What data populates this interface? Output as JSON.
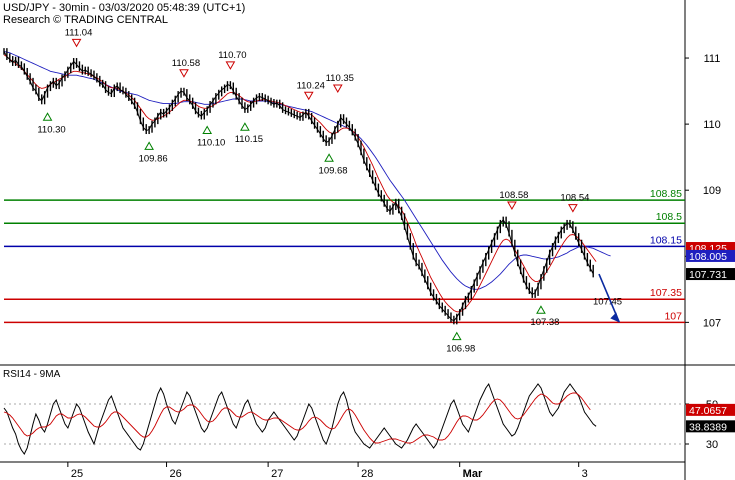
{
  "header": {
    "title": "USD/JPY - 30min - 03/03/2020 05:48:39 (UTC+1)",
    "source": "Research © TRADING CENTRAL"
  },
  "indicator_label": "RSI14 - 9MA",
  "colors": {
    "price": "#000000",
    "ma_fast": "#cc0000",
    "ma_slow": "#1f1fbf",
    "support": "#cc0000",
    "resistance": "#008000",
    "pivot": "#0000aa",
    "rsi": "#000000",
    "rsi_ma": "#cc0000",
    "arrow": "#0a2aa0",
    "grid": "#aaaaaa"
  },
  "chart_data": [
    {
      "type": "candlestick",
      "title": "USD/JPY - 30min",
      "ylim": [
        106.4,
        111.5
      ],
      "y_ticks": [
        "111",
        "110",
        "109",
        "108",
        "107"
      ],
      "x_ticks": [
        "25",
        "26",
        "27",
        "28",
        "Mar",
        "3"
      ],
      "x_range": [
        0,
        205
      ],
      "x_tick_positions": [
        22,
        56,
        91,
        122,
        157,
        198
      ],
      "last_price": "107.731",
      "price_labels": [
        {
          "label": "108.125",
          "value": 108.125,
          "color": "#cc0000"
        },
        {
          "label": "108.005",
          "value": 108.005,
          "color": "#1f1fbf"
        },
        {
          "label": "107.731",
          "value": 107.731,
          "color": "#000000"
        }
      ],
      "levels": [
        {
          "name": "resistance-2",
          "value": 108.85,
          "label": "108.85",
          "color": "#008000"
        },
        {
          "name": "resistance-1",
          "value": 108.5,
          "label": "108.5",
          "color": "#008000"
        },
        {
          "name": "pivot",
          "value": 108.15,
          "label": "108.15",
          "color": "#0000aa"
        },
        {
          "name": "support-1",
          "value": 107.35,
          "label": "107.35",
          "color": "#cc0000"
        },
        {
          "name": "support-2",
          "value": 107.0,
          "label": "107",
          "color": "#cc0000"
        }
      ],
      "swing_points": [
        {
          "x": 25,
          "value": 111.04,
          "label": "111.04",
          "kind": "high"
        },
        {
          "x": 15,
          "value": 110.3,
          "label": "110.30",
          "kind": "low"
        },
        {
          "x": 62,
          "value": 110.58,
          "label": "110.58",
          "kind": "high"
        },
        {
          "x": 78,
          "value": 110.7,
          "label": "110.70",
          "kind": "high"
        },
        {
          "x": 50,
          "value": 109.86,
          "label": "109.86",
          "kind": "low"
        },
        {
          "x": 70,
          "value": 110.1,
          "label": "110.10",
          "kind": "low"
        },
        {
          "x": 83,
          "value": 110.15,
          "label": "110.15",
          "kind": "low"
        },
        {
          "x": 105,
          "value": 110.24,
          "label": "110.24",
          "kind": "high"
        },
        {
          "x": 115,
          "value": 110.35,
          "label": "110.35",
          "kind": "high"
        },
        {
          "x": 112,
          "value": 109.68,
          "label": "109.68",
          "kind": "low"
        },
        {
          "x": 156,
          "value": 106.98,
          "label": "106.98",
          "kind": "low"
        },
        {
          "x": 175,
          "value": 108.58,
          "label": "108.58",
          "kind": "high"
        },
        {
          "x": 196,
          "value": 108.54,
          "label": "108.54",
          "kind": "high"
        },
        {
          "x": 185,
          "value": 107.38,
          "label": "107.38",
          "kind": "low"
        }
      ],
      "projection": {
        "from": [
          205,
          107.731
        ],
        "to": [
          212,
          107.0
        ],
        "label": "107.45"
      },
      "price_series": [
        111.1,
        111.02,
        110.98,
        110.93,
        110.97,
        110.9,
        110.87,
        110.8,
        110.72,
        110.65,
        110.55,
        110.5,
        110.4,
        110.35,
        110.45,
        110.55,
        110.6,
        110.65,
        110.58,
        110.62,
        110.7,
        110.75,
        110.82,
        110.88,
        110.95,
        110.9,
        110.85,
        110.8,
        110.82,
        110.78,
        110.76,
        110.72,
        110.68,
        110.62,
        110.6,
        110.52,
        110.48,
        110.46,
        110.55,
        110.58,
        110.52,
        110.5,
        110.45,
        110.4,
        110.35,
        110.28,
        110.18,
        110.05,
        109.95,
        109.9,
        109.92,
        110.0,
        110.05,
        110.12,
        110.18,
        110.15,
        110.2,
        110.25,
        110.32,
        110.38,
        110.45,
        110.5,
        110.48,
        110.4,
        110.35,
        110.28,
        110.2,
        110.15,
        110.12,
        110.18,
        110.22,
        110.3,
        110.35,
        110.42,
        110.47,
        110.52,
        110.55,
        110.6,
        110.58,
        110.5,
        110.42,
        110.35,
        110.28,
        110.22,
        110.25,
        110.3,
        110.35,
        110.4,
        110.42,
        110.4,
        110.38,
        110.35,
        110.33,
        110.3,
        110.32,
        110.28,
        110.22,
        110.2,
        110.18,
        110.16,
        110.14,
        110.12,
        110.1,
        110.14,
        110.18,
        110.12,
        110.05,
        109.98,
        109.92,
        109.85,
        109.78,
        109.72,
        109.75,
        109.82,
        109.92,
        110.0,
        110.1,
        110.05,
        110.0,
        109.95,
        109.88,
        109.8,
        109.7,
        109.58,
        109.45,
        109.35,
        109.25,
        109.15,
        109.05,
        108.95,
        108.88,
        108.8,
        108.72,
        108.68,
        108.75,
        108.82,
        108.7,
        108.6,
        108.45,
        108.3,
        108.15,
        108.0,
        107.9,
        107.85,
        107.75,
        107.65,
        107.55,
        107.45,
        107.38,
        107.32,
        107.25,
        107.2,
        107.15,
        107.1,
        107.05,
        107.02,
        107.08,
        107.15,
        107.25,
        107.35,
        107.4,
        107.5,
        107.6,
        107.7,
        107.8,
        107.9,
        108.0,
        108.1,
        108.2,
        108.3,
        108.4,
        108.5,
        108.55,
        108.48,
        108.35,
        108.2,
        108.05,
        107.9,
        107.78,
        107.65,
        107.55,
        107.48,
        107.42,
        107.45,
        107.55,
        107.68,
        107.8,
        107.92,
        108.05,
        108.15,
        108.25,
        108.32,
        108.4,
        108.45,
        108.5,
        108.48,
        108.4,
        108.3,
        108.2,
        108.1,
        108.0,
        107.9,
        107.82,
        107.731
      ],
      "ma_fast_series": [
        111.05,
        111.02,
        110.98,
        110.95,
        110.92,
        110.88,
        110.84,
        110.8,
        110.75,
        110.7,
        110.65,
        110.6,
        110.56,
        110.54,
        110.55,
        110.57,
        110.6,
        110.63,
        110.65,
        110.68,
        110.7,
        110.72,
        110.75,
        110.78,
        110.8,
        110.8,
        110.79,
        110.78,
        110.77,
        110.76,
        110.74,
        110.72,
        110.7,
        110.67,
        110.64,
        110.6,
        110.57,
        110.55,
        110.55,
        110.54,
        110.52,
        110.5,
        110.47,
        110.44,
        110.4,
        110.36,
        110.3,
        110.24,
        110.18,
        110.12,
        110.08,
        110.06,
        110.06,
        110.08,
        110.1,
        110.12,
        110.15,
        110.18,
        110.22,
        110.26,
        110.3,
        110.34,
        110.36,
        110.36,
        110.35,
        110.33,
        110.3,
        110.27,
        110.25,
        110.24,
        110.24,
        110.26,
        110.28,
        110.31,
        110.34,
        110.38,
        110.42,
        110.46,
        110.48,
        110.48,
        110.46,
        110.43,
        110.4,
        110.36,
        110.34,
        110.33,
        110.34,
        110.35,
        110.36,
        110.37,
        110.37,
        110.36,
        110.35,
        110.34,
        110.33,
        110.32,
        110.3,
        110.28,
        110.26,
        110.24,
        110.22,
        110.2,
        110.18,
        110.17,
        110.17,
        110.16,
        110.14,
        110.1,
        110.06,
        110.02,
        109.97,
        109.92,
        109.88,
        109.86,
        109.86,
        109.88,
        109.92,
        109.94,
        109.94,
        109.93,
        109.9,
        109.86,
        109.8,
        109.73,
        109.65,
        109.56,
        109.47,
        109.38,
        109.28,
        109.18,
        109.09,
        109.0,
        108.92,
        108.86,
        108.82,
        108.8,
        108.76,
        108.7,
        108.62,
        108.52,
        108.41,
        108.3,
        108.18,
        108.08,
        107.98,
        107.88,
        107.78,
        107.68,
        107.6,
        107.52,
        107.44,
        107.37,
        107.31,
        107.26,
        107.22,
        107.18,
        107.16,
        107.16,
        107.18,
        107.22,
        107.27,
        107.33,
        107.4,
        107.48,
        107.56,
        107.65,
        107.74,
        107.83,
        107.92,
        108.01,
        108.1,
        108.18,
        108.24,
        108.26,
        108.24,
        108.18,
        108.1,
        108.02,
        107.94,
        107.86,
        107.78,
        107.7,
        107.65,
        107.62,
        107.62,
        107.65,
        107.7,
        107.77,
        107.84,
        107.92,
        108.0,
        108.08,
        108.15,
        108.22,
        108.28,
        108.32,
        108.33,
        108.31,
        108.27,
        108.22,
        108.16,
        108.1,
        108.04,
        107.98,
        107.92
      ],
      "ma_slow_series": [
        111.1,
        111.09,
        111.08,
        111.06,
        111.04,
        111.02,
        111.0,
        110.98,
        110.96,
        110.94,
        110.92,
        110.9,
        110.88,
        110.86,
        110.84,
        110.82,
        110.8,
        110.79,
        110.78,
        110.77,
        110.76,
        110.75,
        110.74,
        110.74,
        110.74,
        110.74,
        110.73,
        110.72,
        110.71,
        110.7,
        110.69,
        110.68,
        110.66,
        110.64,
        110.62,
        110.6,
        110.58,
        110.56,
        110.54,
        110.52,
        110.5,
        110.49,
        110.48,
        110.47,
        110.46,
        110.45,
        110.44,
        110.42,
        110.4,
        110.38,
        110.36,
        110.35,
        110.34,
        110.33,
        110.32,
        110.31,
        110.31,
        110.31,
        110.31,
        110.31,
        110.32,
        110.33,
        110.34,
        110.34,
        110.34,
        110.34,
        110.33,
        110.32,
        110.31,
        110.3,
        110.3,
        110.3,
        110.31,
        110.32,
        110.33,
        110.34,
        110.35,
        110.36,
        110.37,
        110.38,
        110.38,
        110.38,
        110.38,
        110.37,
        110.36,
        110.35,
        110.35,
        110.35,
        110.35,
        110.35,
        110.35,
        110.34,
        110.33,
        110.32,
        110.31,
        110.3,
        110.29,
        110.28,
        110.27,
        110.26,
        110.25,
        110.24,
        110.23,
        110.22,
        110.21,
        110.2,
        110.19,
        110.17,
        110.15,
        110.13,
        110.11,
        110.09,
        110.07,
        110.05,
        110.03,
        110.01,
        109.99,
        109.97,
        109.95,
        109.92,
        109.89,
        109.86,
        109.82,
        109.78,
        109.73,
        109.68,
        109.62,
        109.56,
        109.5,
        109.43,
        109.36,
        109.29,
        109.22,
        109.15,
        109.09,
        109.03,
        108.97,
        108.91,
        108.85,
        108.78,
        108.71,
        108.64,
        108.57,
        108.5,
        108.43,
        108.36,
        108.29,
        108.22,
        108.15,
        108.08,
        108.01,
        107.94,
        107.88,
        107.82,
        107.76,
        107.71,
        107.66,
        107.62,
        107.58,
        107.55,
        107.53,
        107.51,
        107.5,
        107.5,
        107.51,
        107.53,
        107.55,
        107.58,
        107.61,
        107.65,
        107.69,
        107.73,
        107.78,
        107.83,
        107.88,
        107.92,
        107.96,
        107.99,
        108.01,
        108.02,
        108.02,
        108.01,
        108.0,
        107.99,
        107.98,
        107.97,
        107.96,
        107.96,
        107.96,
        107.97,
        107.98,
        107.99,
        108.01,
        108.03,
        108.05,
        108.08,
        108.1,
        108.12,
        108.14,
        108.15,
        108.15,
        108.14,
        108.13,
        108.12,
        108.1,
        108.08,
        108.06,
        108.04,
        108.02,
        108.005
      ]
    },
    {
      "type": "line",
      "title": "RSI14 - 9MA",
      "ylim": [
        22,
        68
      ],
      "y_ticks": [
        "50",
        "30"
      ],
      "rsi_value": "38.8389",
      "ma_value": "47.0657",
      "rsi_series": [
        48,
        46,
        42,
        38,
        35,
        30,
        27,
        25,
        28,
        34,
        40,
        45,
        42,
        38,
        36,
        40,
        45,
        50,
        52,
        48,
        44,
        40,
        38,
        42,
        46,
        50,
        48,
        44,
        40,
        36,
        33,
        30,
        35,
        40,
        44,
        48,
        52,
        54,
        50,
        46,
        42,
        38,
        36,
        34,
        32,
        30,
        28,
        27,
        30,
        35,
        40,
        45,
        50,
        55,
        58,
        55,
        50,
        46,
        42,
        40,
        44,
        48,
        52,
        56,
        54,
        50,
        46,
        42,
        38,
        36,
        38,
        42,
        46,
        50,
        54,
        56,
        52,
        48,
        44,
        40,
        38,
        42,
        46,
        50,
        52,
        48,
        44,
        40,
        38,
        36,
        38,
        42,
        44,
        46,
        44,
        42,
        40,
        38,
        36,
        34,
        32,
        34,
        38,
        42,
        46,
        50,
        48,
        44,
        40,
        36,
        32,
        30,
        34,
        38,
        44,
        50,
        54,
        56,
        52,
        46,
        40,
        36,
        34,
        32,
        30,
        29,
        28,
        30,
        32,
        34,
        36,
        38,
        36,
        34,
        32,
        30,
        29,
        28,
        30,
        32,
        35,
        38,
        40,
        38,
        36,
        34,
        32,
        30,
        28,
        30,
        34,
        38,
        42,
        46,
        50,
        52,
        48,
        44,
        40,
        38,
        36,
        40,
        44,
        48,
        52,
        55,
        58,
        60,
        56,
        52,
        48,
        44,
        40,
        38,
        36,
        34,
        35,
        38,
        42,
        46,
        50,
        54,
        56,
        58,
        60,
        58,
        54,
        50,
        46,
        44,
        46,
        48,
        52,
        56,
        58,
        60,
        58,
        56,
        54,
        50,
        46,
        44,
        42,
        40,
        38.8389
      ],
      "ma_series": [
        46,
        45.5,
        44.5,
        43,
        41,
        39,
        37,
        35,
        34,
        34.5,
        35.5,
        37,
        38,
        38.5,
        38.5,
        39,
        40,
        42,
        44,
        45,
        45,
        44,
        43,
        43,
        43.5,
        44.5,
        45,
        44.5,
        43.5,
        42,
        40.5,
        39,
        38.5,
        38.5,
        39.5,
        41,
        43,
        45,
        46,
        46,
        45,
        43.5,
        42,
        40.5,
        39,
        37.5,
        36,
        34.5,
        33.5,
        33.5,
        34.5,
        36.5,
        39,
        42,
        45,
        47.5,
        48.5,
        48.5,
        47.5,
        46.5,
        46,
        46.5,
        47.5,
        49,
        49.5,
        49.5,
        48.5,
        47,
        45,
        43,
        41.5,
        41,
        41.5,
        43,
        45,
        47,
        48,
        48,
        47,
        45.5,
        44,
        43.5,
        43.5,
        44.5,
        45.5,
        46,
        45.5,
        44.5,
        43.5,
        42.5,
        42,
        42,
        42.5,
        43,
        43,
        42.5,
        41.5,
        40.5,
        39.5,
        38.5,
        37.5,
        37,
        37,
        38,
        39.5,
        41.5,
        43,
        43.5,
        43,
        42,
        40.5,
        39,
        38,
        37.5,
        38,
        40,
        42.5,
        45,
        47,
        47.5,
        46.5,
        44.5,
        42,
        39.5,
        37,
        35,
        33,
        31.5,
        30.5,
        30.5,
        31,
        31.5,
        32,
        32.5,
        32.5,
        32.5,
        32,
        31.5,
        31,
        30.5,
        30.5,
        31,
        32,
        33,
        34,
        34.5,
        34.5,
        34,
        33.5,
        32.5,
        32,
        32,
        32.5,
        34,
        36,
        38.5,
        41,
        43,
        44,
        44,
        43.5,
        42.5,
        42,
        42,
        43,
        44.5,
        46.5,
        48.5,
        50.5,
        52,
        52.5,
        52,
        50.5,
        48.5,
        46.5,
        44.5,
        43,
        42.5,
        43,
        44.5,
        46.5,
        48.5,
        50.5,
        52.5,
        54,
        55,
        54.5,
        53.5,
        52,
        50.5,
        50,
        50,
        51,
        52.5,
        54,
        55,
        55.5,
        55.5,
        54.5,
        53,
        51,
        49,
        47.0657
      ]
    }
  ]
}
